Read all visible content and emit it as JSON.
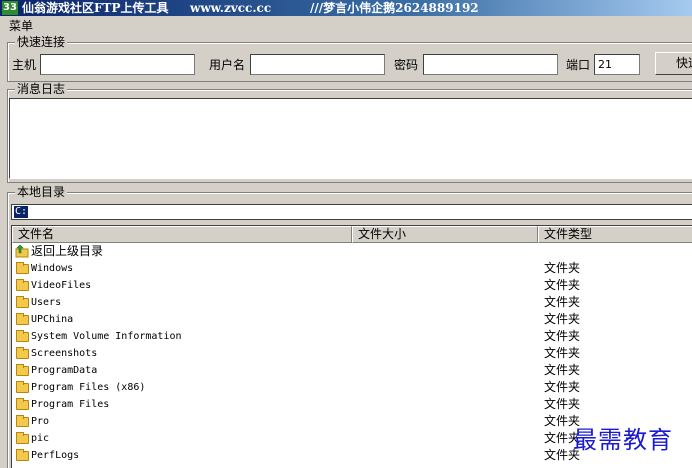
{
  "window": {
    "icon_text": "33",
    "title": "仙翁游戏社区FTP上传工具",
    "site": "www.zvcc.cc",
    "author": "///梦言小伟企鹅2624889192"
  },
  "menu": {
    "label": "菜单"
  },
  "quick_connect": {
    "title": "快速连接",
    "host_label": "主机",
    "host_value": "",
    "user_label": "用户名",
    "user_value": "",
    "password_label": "密码",
    "password_value": "",
    "port_label": "端口",
    "port_value": "21",
    "connect_button": "快速连接"
  },
  "log": {
    "title": "消息日志"
  },
  "local": {
    "title": "本地目录",
    "path": "C:",
    "columns": [
      "文件名",
      "文件大小",
      "文件类型"
    ],
    "up_label": "返回上级目录",
    "rows": [
      {
        "name": "Windows",
        "size": "",
        "type": "文件夹"
      },
      {
        "name": "VideoFiles",
        "size": "",
        "type": "文件夹"
      },
      {
        "name": "Users",
        "size": "",
        "type": "文件夹"
      },
      {
        "name": "UPChina",
        "size": "",
        "type": "文件夹"
      },
      {
        "name": "System Volume Information",
        "size": "",
        "type": "文件夹"
      },
      {
        "name": "Screenshots",
        "size": "",
        "type": "文件夹"
      },
      {
        "name": "ProgramData",
        "size": "",
        "type": "文件夹"
      },
      {
        "name": "Program Files (x86)",
        "size": "",
        "type": "文件夹"
      },
      {
        "name": "Program Files",
        "size": "",
        "type": "文件夹"
      },
      {
        "name": "Pro",
        "size": "",
        "type": "文件夹"
      },
      {
        "name": "pic",
        "size": "",
        "type": "文件夹"
      },
      {
        "name": "PerfLogs",
        "size": "",
        "type": "文件夹"
      }
    ]
  },
  "watermark": "最需教育"
}
